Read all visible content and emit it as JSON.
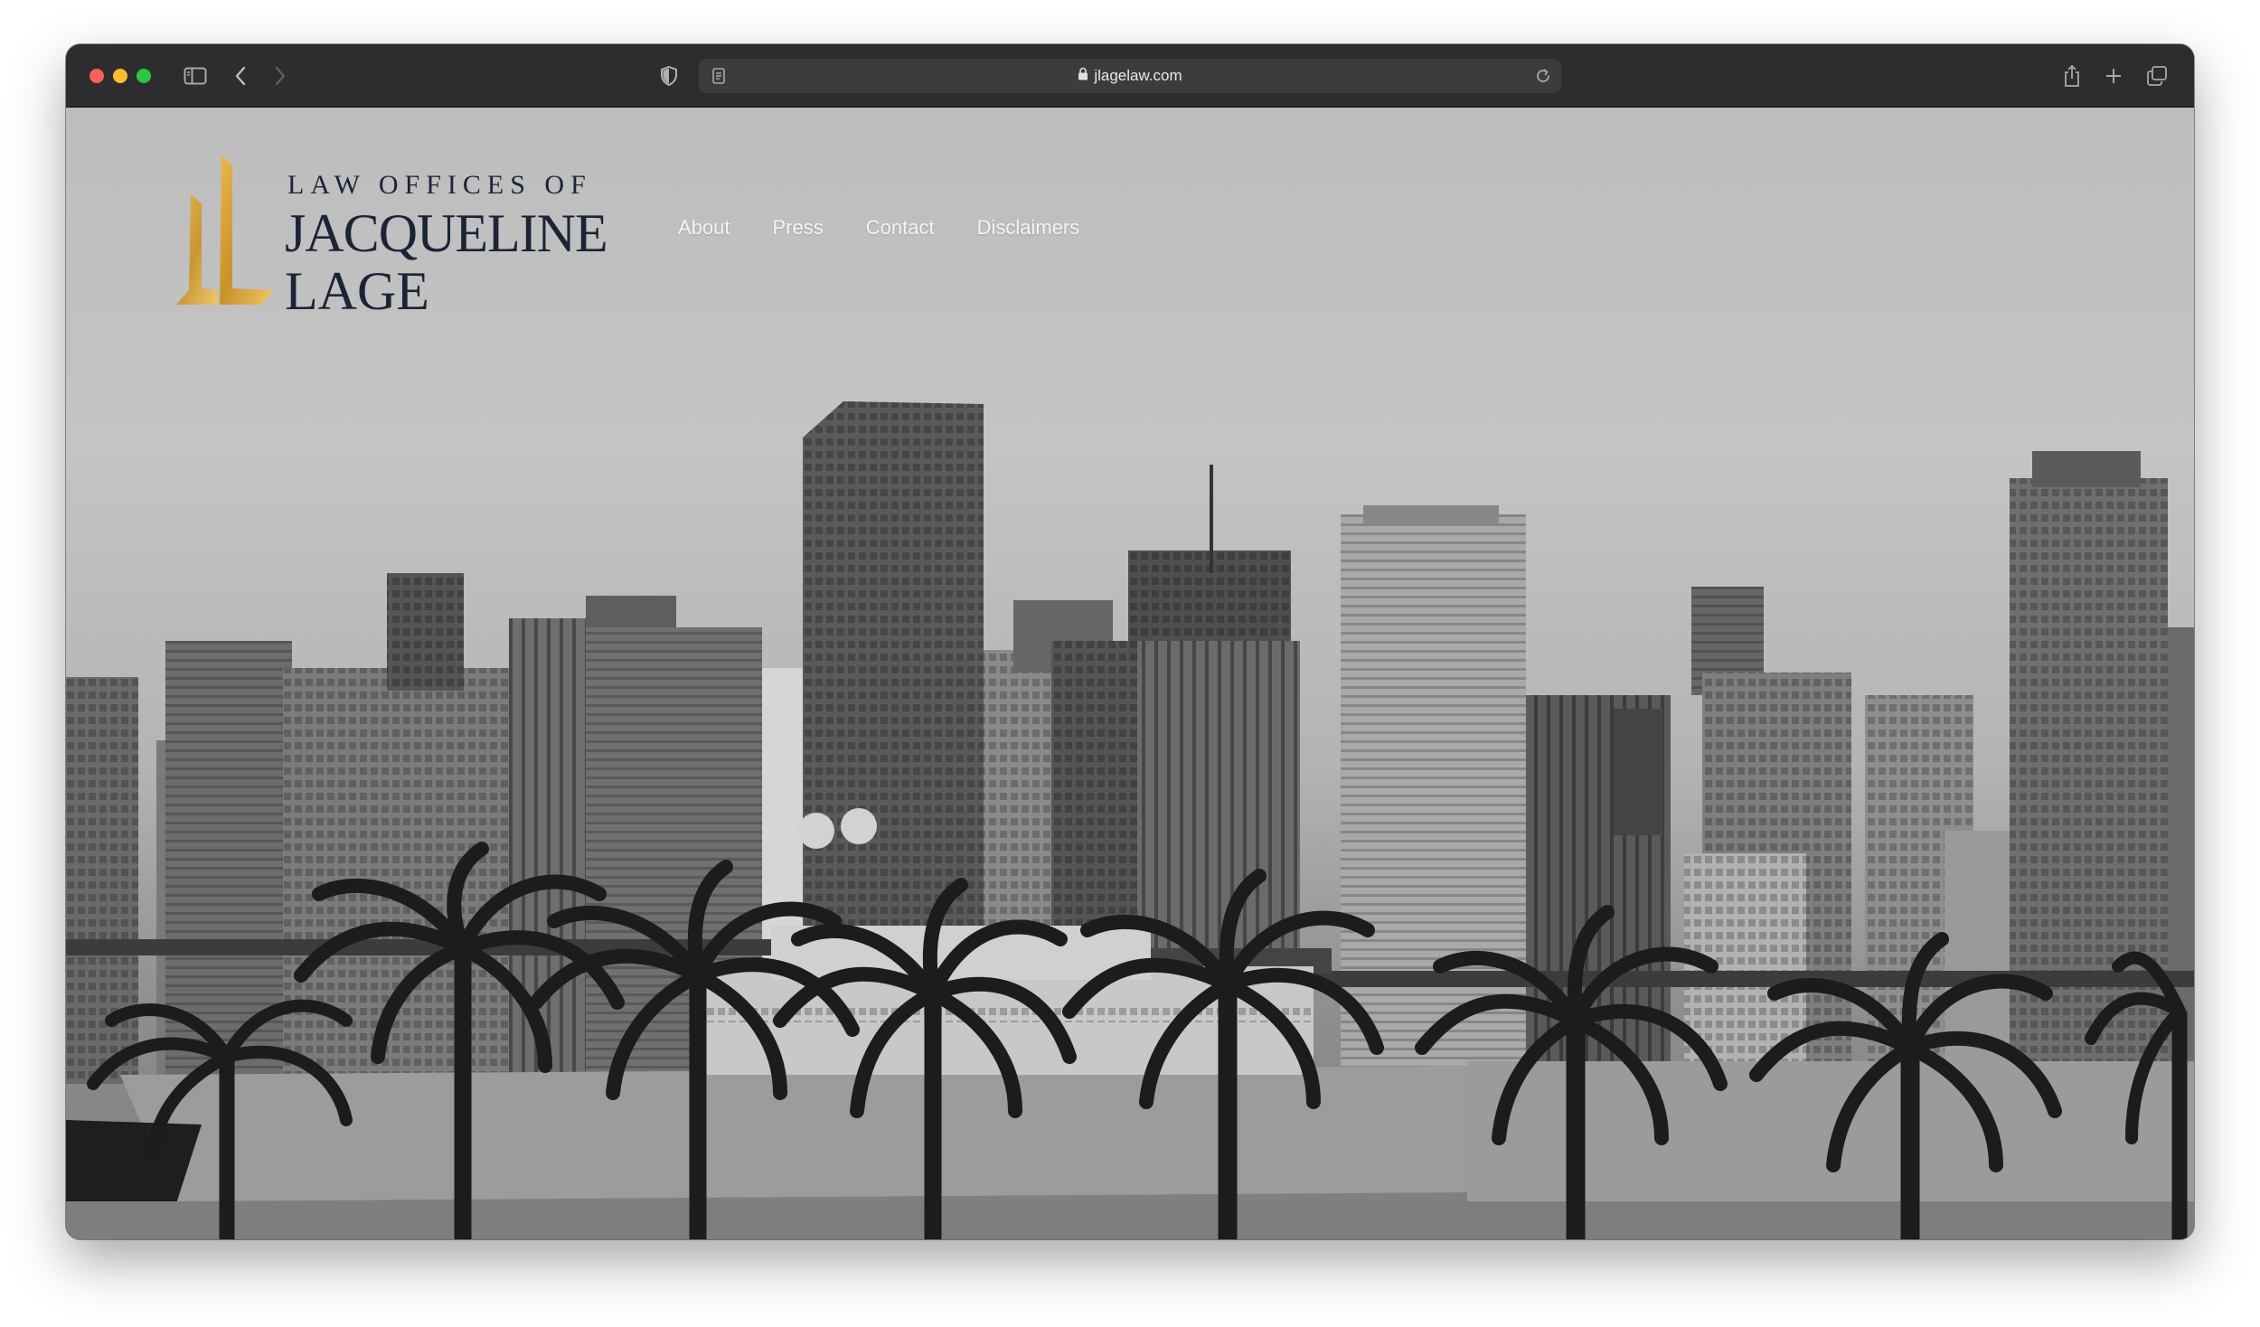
{
  "browser": {
    "url": "jlagelaw.com",
    "icons": {
      "sidebar": "sidebar-icon",
      "back": "chevron-left-icon",
      "forward": "chevron-right-icon",
      "privacy": "shield-icon",
      "reader": "reader-icon",
      "lock": "lock-icon",
      "reload": "reload-icon",
      "share": "share-icon",
      "new_tab": "plus-icon",
      "tabs": "tabs-overview-icon"
    },
    "traffic_lights": {
      "close": "#ff5f57",
      "minimize": "#febc2e",
      "zoom": "#28c840"
    }
  },
  "site": {
    "logo": {
      "pre": "LAW OFFICES OF",
      "first_name": "JACQUELINE",
      "last_name": "LAGE",
      "text_color": "#1b2437",
      "mark_color": "#c9922a"
    },
    "nav": {
      "about": "About",
      "press": "Press",
      "contact": "Contact",
      "disclaimers": "Disclaimers"
    },
    "hero_image": "black-and-white Miami skyline with palm trees and yacht"
  }
}
